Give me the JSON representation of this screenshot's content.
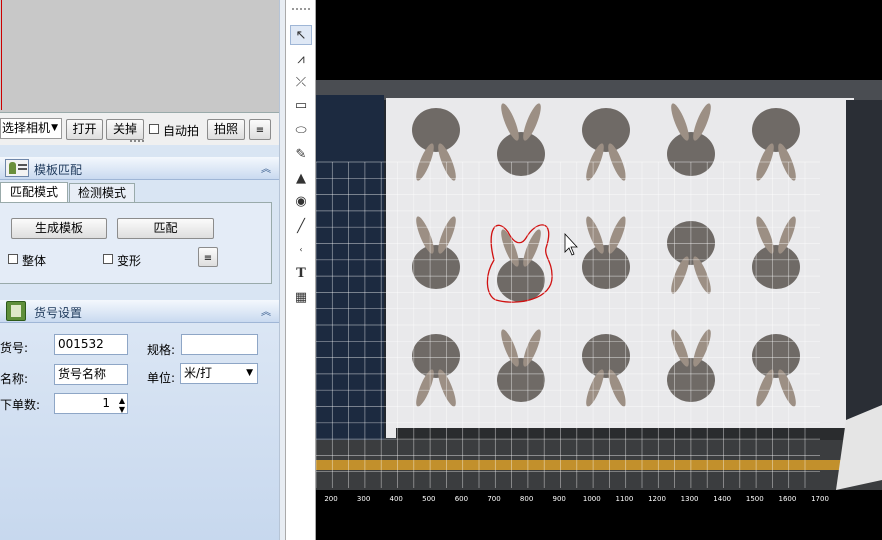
{
  "camera_bar": {
    "camera_select": "选择相机",
    "open_button": "打开",
    "close_button": "关掉",
    "auto_capture_label": "自动拍",
    "capture_button": "拍照"
  },
  "template_panel": {
    "title": "模板匹配",
    "tabs": [
      "匹配模式",
      "检测模式"
    ],
    "active_tab": 0,
    "generate_button": "生成模板",
    "match_button": "匹配",
    "whole_label": "整体",
    "deform_label": "变形"
  },
  "item_panel": {
    "title": "货号设置",
    "item_no_label": "货号:",
    "item_no_value": "001532",
    "spec_label": "规格:",
    "spec_value": "",
    "name_label": "名称:",
    "name_value": "货号名称",
    "unit_label": "单位:",
    "unit_value": "米/打",
    "order_qty_label": "下单数:",
    "order_qty_value": "1"
  },
  "toolbar": {
    "tools": [
      "select-arrow-icon",
      "node-edit-icon",
      "connect-icon",
      "rectangle-icon",
      "ellipse-icon",
      "pen-icon",
      "triangle-icon",
      "fill-icon",
      "line-icon",
      "point-icon",
      "text-icon",
      "grid-icon"
    ],
    "text_tool_glyph": "T"
  },
  "ruler": {
    "ticks": [
      "200",
      "300",
      "400",
      "500",
      "600",
      "700",
      "800",
      "900",
      "1000",
      "1100",
      "1200",
      "1300",
      "1400",
      "1500",
      "1600",
      "1700"
    ]
  },
  "colors": {
    "selection_outline": "#d01010",
    "grid": "#ffffff",
    "panel_header": "#c9daf0"
  }
}
